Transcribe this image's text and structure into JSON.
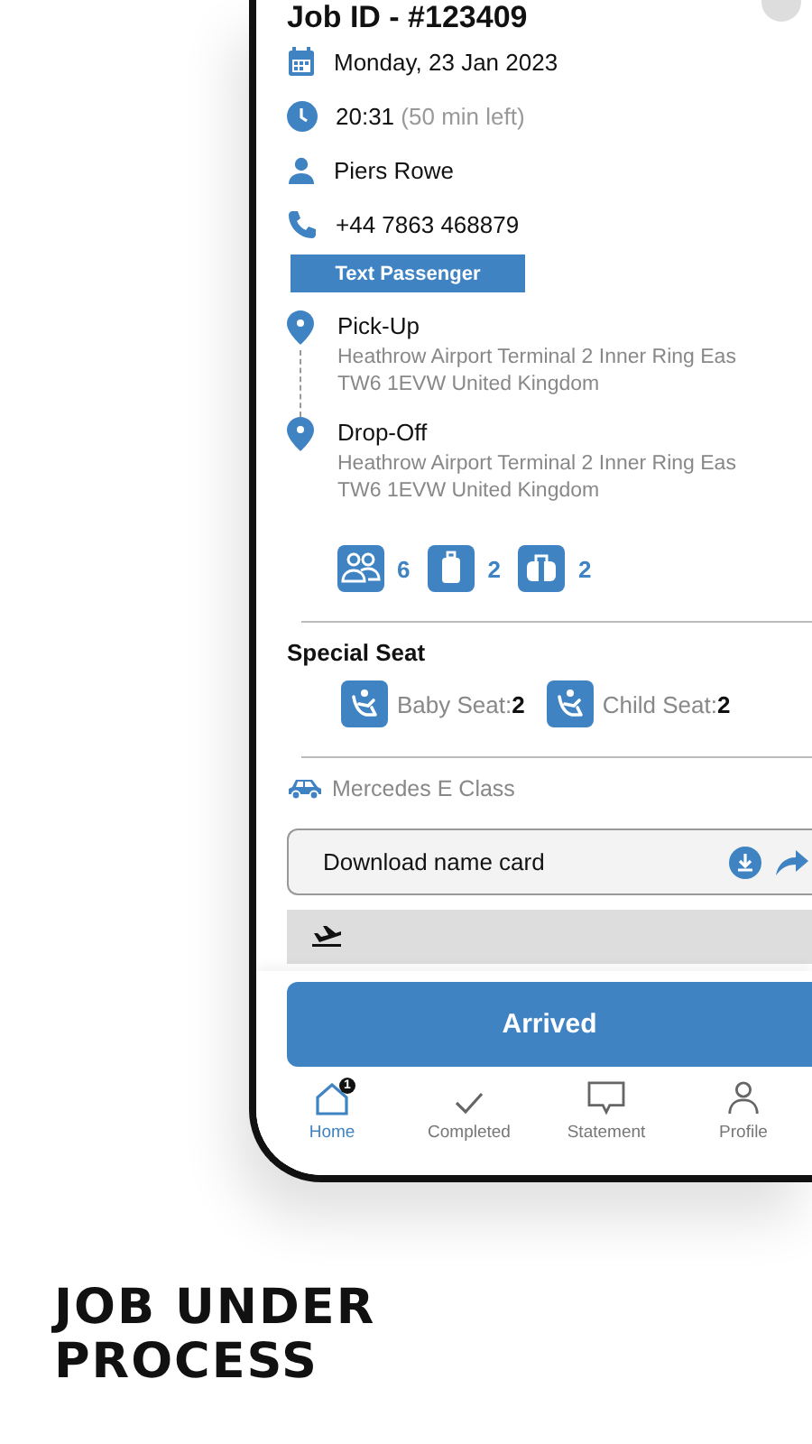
{
  "job": {
    "title": "Job ID - #123409"
  },
  "details": {
    "date": "Monday, 23 Jan 2023",
    "time": "20:31",
    "time_left": "(50 min left)",
    "passenger": "Piers Rowe",
    "phone": "+44 7863 468879"
  },
  "text_button": "Text Passenger",
  "stops": [
    {
      "label": "Pick-Up",
      "address_lines": [
        "Heathrow Airport Terminal 2 Inner Ring Eas",
        "TW6 1EVW United Kingdom"
      ]
    },
    {
      "label": "Drop-Off",
      "address_lines": [
        "Heathrow Airport Terminal 2 Inner Ring Eas",
        "TW6 1EVW United Kingdom"
      ]
    }
  ],
  "counts": [
    {
      "kind": "passengers",
      "value": "6"
    },
    {
      "kind": "suitcase",
      "value": "2"
    },
    {
      "kind": "bag",
      "value": "2"
    }
  ],
  "special_seat": {
    "title": "Special Seat",
    "seats": [
      {
        "label": "Baby Seat:",
        "count": "2"
      },
      {
        "label": "Child Seat:",
        "count": "2"
      }
    ]
  },
  "vehicle": "Mercedes E Class",
  "download": {
    "label": "Download name card"
  },
  "primary_button": "Arrived",
  "nav": [
    {
      "kind": "home",
      "label": "Home",
      "selected": true,
      "badge": "1"
    },
    {
      "kind": "completed",
      "label": "Completed",
      "selected": false
    },
    {
      "kind": "statement",
      "label": "Statement",
      "selected": false
    },
    {
      "kind": "profile",
      "label": "Profile",
      "selected": false
    }
  ],
  "caption": "JOB UNDER PROCESS"
}
